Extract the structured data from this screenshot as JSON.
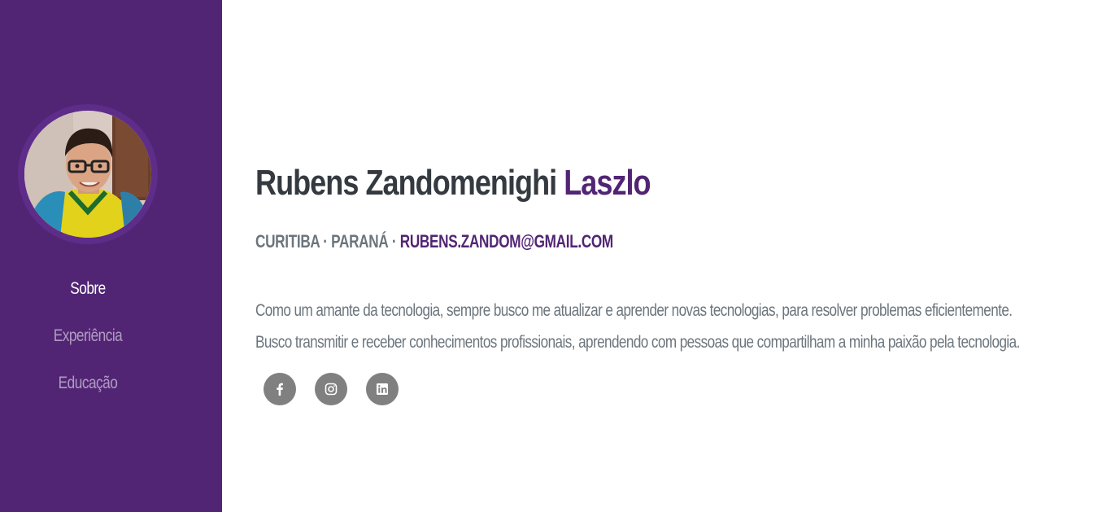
{
  "sidebar": {
    "nav": [
      {
        "label": "Sobre",
        "active": true
      },
      {
        "label": "Experiência",
        "active": false
      },
      {
        "label": "Educação",
        "active": false
      }
    ],
    "colors": {
      "background": "#512574",
      "ring": "#5e2d8a"
    }
  },
  "profile": {
    "first_names": "Rubens Zandomenighi",
    "last_name": "Laszlo",
    "location": "Curitiba · Paraná ·",
    "email": "rubens.zandom@gmail.com",
    "bio": [
      "Como um amante da tecnologia, sempre busco me atualizar e aprender novas tecnologias, para resolver problemas eficientemente.",
      "Busco transmitir e receber conhecimentos profissionais, aprendendo com pessoas que compartilham a minha paixão pela tecnologia."
    ]
  },
  "social": [
    {
      "icon": "facebook-icon"
    },
    {
      "icon": "instagram-icon"
    },
    {
      "icon": "linkedin-icon"
    }
  ],
  "colors": {
    "accent": "#512574",
    "heading": "#343a40",
    "muted": "#6c757d",
    "social_button": "#808080"
  }
}
